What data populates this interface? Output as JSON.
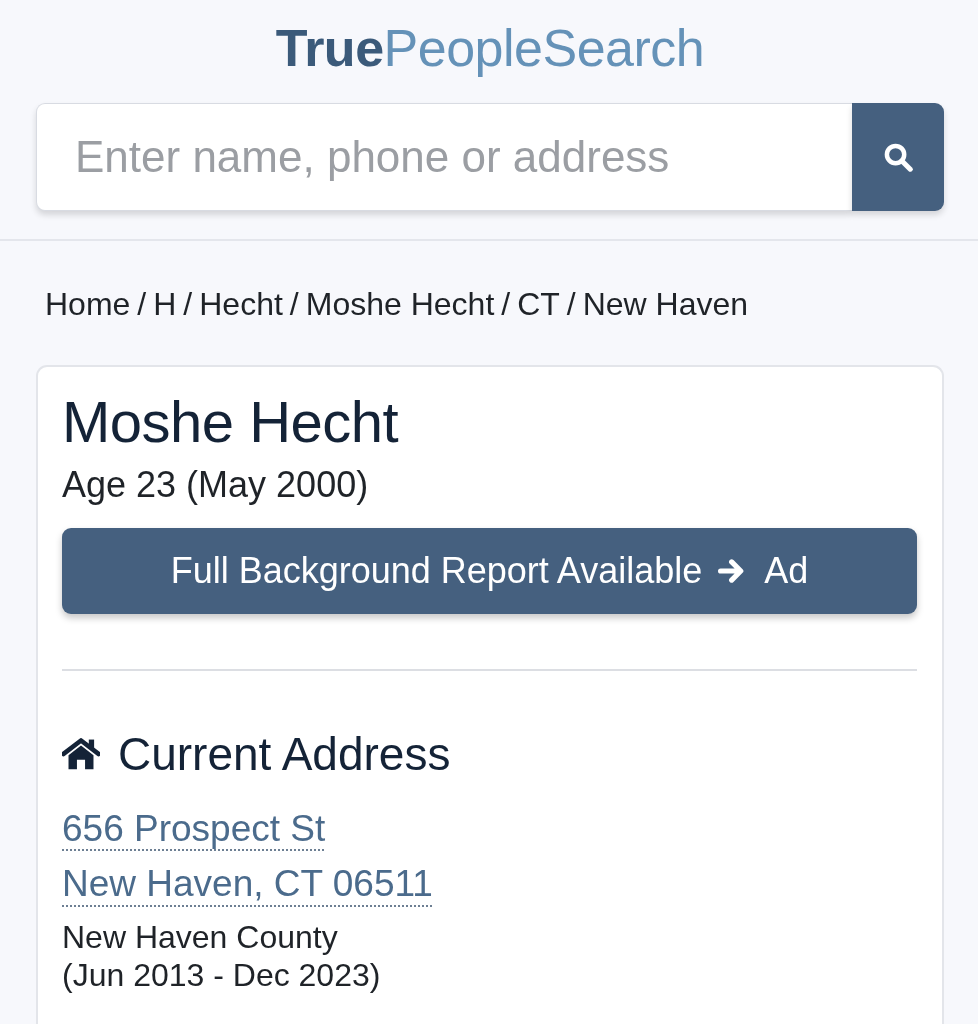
{
  "logo": "**True**PeopleSearch",
  "search": {
    "placeholder": "Enter name, phone or address"
  },
  "breadcrumb": {
    "separator": "/",
    "items": [
      "Home",
      "H",
      "Hecht",
      "Moshe Hecht",
      "CT",
      "New Haven"
    ]
  },
  "person": {
    "name": "Moshe Hecht",
    "age": "Age 23 (May 2000)",
    "report_button": {
      "label": "Full Background Report Available",
      "tag": "Ad"
    }
  },
  "current_address": {
    "heading": "Current Address",
    "lines": [
      "656 Prospect St",
      "New Haven, CT 06511"
    ],
    "county": "New Haven County",
    "dates": "(Jun 2013 - Dec 2023)"
  }
}
